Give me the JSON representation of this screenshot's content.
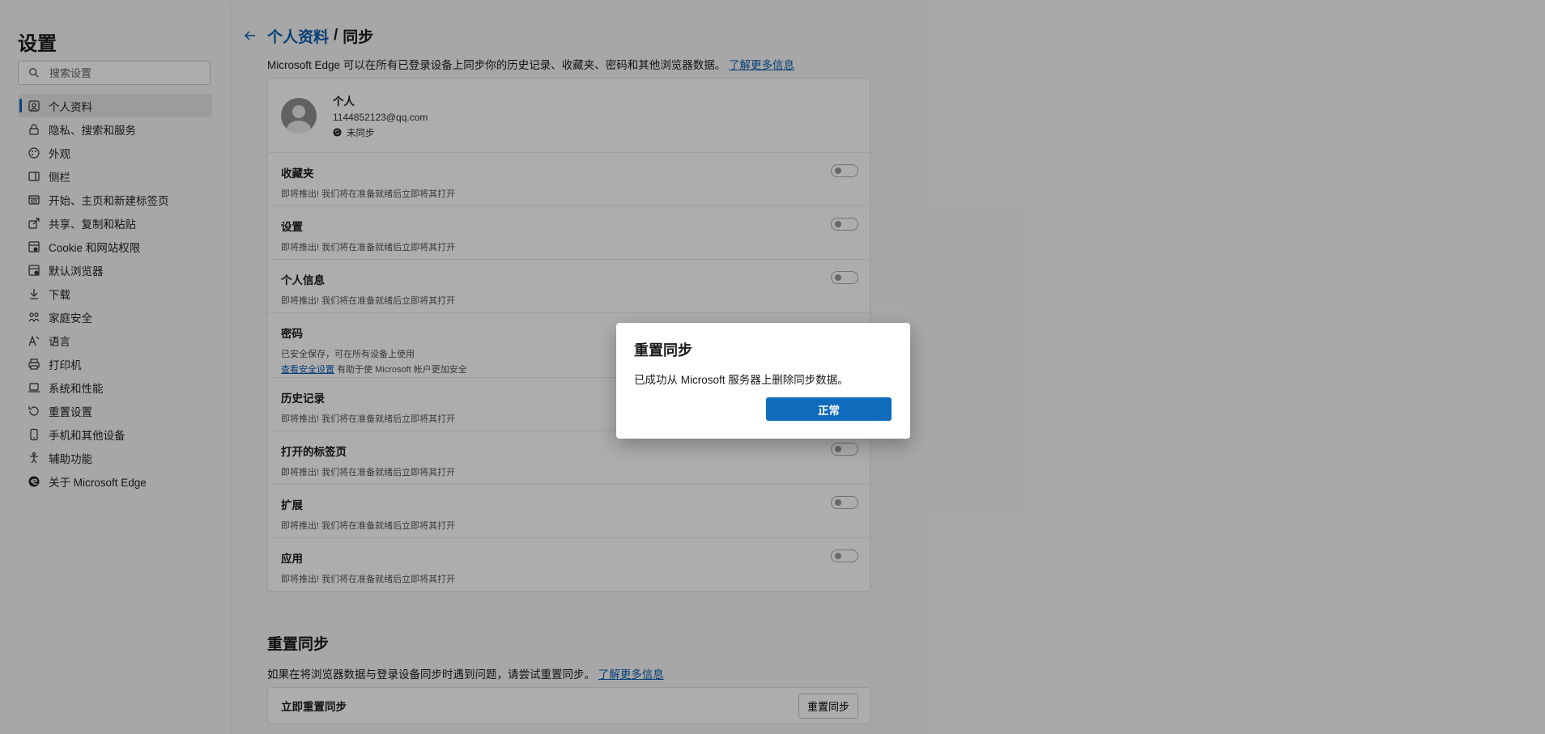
{
  "sidebar": {
    "title": "设置",
    "search_placeholder": "搜索设置",
    "items": [
      {
        "label": "个人资料",
        "icon": "profile-icon",
        "active": true
      },
      {
        "label": "隐私、搜索和服务",
        "icon": "lock-icon"
      },
      {
        "label": "外观",
        "icon": "appearance-icon"
      },
      {
        "label": "侧栏",
        "icon": "sidebar-icon"
      },
      {
        "label": "开始、主页和新建标签页",
        "icon": "home-icon"
      },
      {
        "label": "共享、复制和粘贴",
        "icon": "share-icon"
      },
      {
        "label": "Cookie 和网站权限",
        "icon": "cookie-icon"
      },
      {
        "label": "默认浏览器",
        "icon": "browser-icon"
      },
      {
        "label": "下载",
        "icon": "download-icon"
      },
      {
        "label": "家庭安全",
        "icon": "family-icon"
      },
      {
        "label": "语言",
        "icon": "language-icon"
      },
      {
        "label": "打印机",
        "icon": "printer-icon"
      },
      {
        "label": "系统和性能",
        "icon": "laptop-icon"
      },
      {
        "label": "重置设置",
        "icon": "reset-icon"
      },
      {
        "label": "手机和其他设备",
        "icon": "phone-icon"
      },
      {
        "label": "辅助功能",
        "icon": "accessibility-icon"
      },
      {
        "label": "关于 Microsoft Edge",
        "icon": "edge-logo-icon"
      }
    ]
  },
  "main": {
    "breadcrumb_parent": "个人资料",
    "breadcrumb_sep": "/",
    "breadcrumb_current": "同步",
    "intro_text": "Microsoft Edge 可以在所有已登录设备上同步你的历史记录、收藏夹、密码和其他浏览器数据。",
    "intro_link": "了解更多信息",
    "profile": {
      "name": "个人",
      "email": "1144852123@qq.com",
      "status": "未同步"
    },
    "sync_items": [
      {
        "title": "收藏夹",
        "desc": "即将推出! 我们将在准备就绪后立即将其打开",
        "toggle": false
      },
      {
        "title": "设置",
        "desc": "即将推出! 我们将在准备就绪后立即将其打开",
        "toggle": false
      },
      {
        "title": "个人信息",
        "desc": "即将推出! 我们将在准备就绪后立即将其打开",
        "toggle": false
      },
      {
        "title": "密码",
        "desc": "已安全保存，可在所有设备上使用",
        "link": "查看安全设置",
        "desc2": "有助于使 Microsoft 帐户更加安全"
      },
      {
        "title": "历史记录",
        "desc": "即将推出! 我们将在准备就绪后立即将其打开",
        "toggle": false
      },
      {
        "title": "打开的标签页",
        "desc": "即将推出! 我们将在准备就绪后立即将其打开",
        "toggle": false
      },
      {
        "title": "扩展",
        "desc": "即将推出! 我们将在准备就绪后立即将其打开",
        "toggle": false
      },
      {
        "title": "应用",
        "desc": "即将推出! 我们将在准备就绪后立即将其打开",
        "toggle": false
      }
    ],
    "reset": {
      "title": "重置同步",
      "desc": "如果在将浏览器数据与登录设备同步时遇到问题，请尝试重置同步。",
      "link": "了解更多信息",
      "row_label": "立即重置同步",
      "button": "重置同步"
    }
  },
  "dialog": {
    "title": "重置同步",
    "message": "已成功从 Microsoft 服务器上删除同步数据。",
    "ok_button": "正常"
  },
  "colors": {
    "accent": "#0f6cbd",
    "link": "#0a5db0",
    "overlay": "rgba(0,0,0,0.32)"
  }
}
